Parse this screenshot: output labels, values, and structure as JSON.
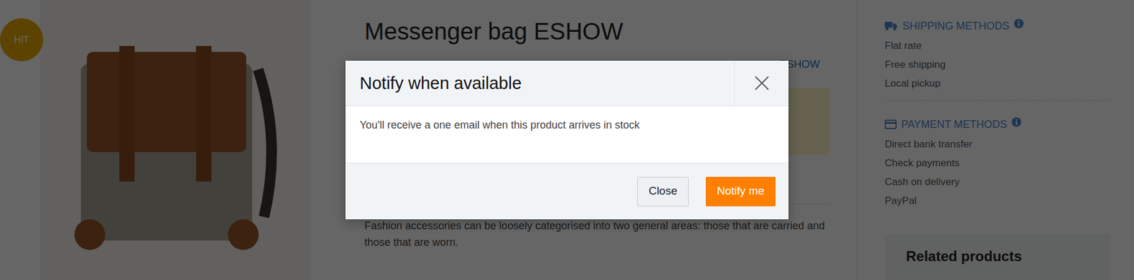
{
  "badge": "HIT",
  "product": {
    "title": "Messenger bag ESHOW",
    "brand": "ESHOW",
    "description": "Fashion accessories can be loosely categorised into two general areas: those that are carried and those that are worn."
  },
  "sidebar": {
    "sections": [
      {
        "title": "SHIPPING METHODS",
        "items": [
          "Flat rate",
          "Free shipping",
          "Local pickup"
        ]
      },
      {
        "title": "PAYMENT METHODS",
        "items": [
          "Direct bank transfer",
          "Check payments",
          "Cash on delivery",
          "PayPal"
        ]
      }
    ]
  },
  "related": {
    "title": "Related products"
  },
  "modal": {
    "title": "Notify when available",
    "message": "You'll receive a one email when this product arrives in stock",
    "buttons": [
      {
        "label": "Close",
        "kind": "plain"
      },
      {
        "label": "Notify me",
        "kind": "primary"
      }
    ]
  }
}
